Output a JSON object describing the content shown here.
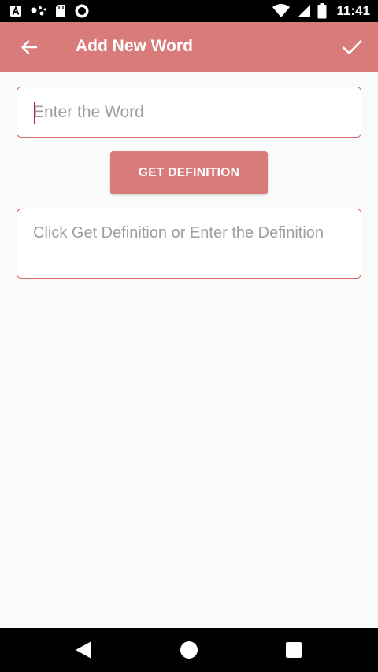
{
  "status_bar": {
    "time": "11:41",
    "icons": [
      "font-icon",
      "dots-icon",
      "sd-card-icon",
      "sync-icon",
      "wifi-icon",
      "cell-signal-icon",
      "battery-icon"
    ]
  },
  "app_bar": {
    "title": "Add New Word",
    "back_icon": "arrow-left-icon",
    "confirm_icon": "check-icon"
  },
  "form": {
    "word_placeholder": "Enter the Word",
    "word_value": "",
    "get_definition_label": "GET DEFINITION",
    "definition_placeholder": "Click Get Definition or Enter the Definition",
    "definition_value": ""
  },
  "nav_bar": {
    "icons": [
      "nav-back-icon",
      "nav-home-icon",
      "nav-recents-icon"
    ]
  },
  "colors": {
    "primary": "#d97b7b",
    "field_border": "#d9696c",
    "caret": "#c2185b",
    "background": "#fafafa"
  }
}
